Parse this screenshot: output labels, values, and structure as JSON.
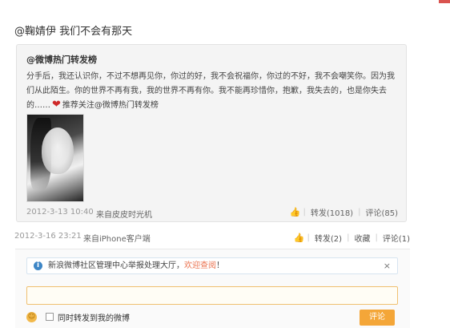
{
  "post": {
    "text": "@鞠婧伊 我们不会有那天",
    "time": "2012-3-16 23:21",
    "source": "来自iPhone客户端",
    "actions": {
      "forward": "转发(2)",
      "favorite": "收藏",
      "comment": "评论(1)"
    }
  },
  "original": {
    "author": "@微博热门转发榜",
    "text": "分手后，我还认识你，不过不想再见你，你过的好，我不会祝福你，你过的不好，我不会嘲笑你。因为我们从此陌生。你的世界不再有我，我的世界不再有你。我不能再珍惜你，抱歉，我失去的，也是你失去的……",
    "recommend": "推荐关注@微博热门转发榜",
    "time": "2012-3-13 10:40",
    "source": "来自皮皮时光机",
    "actions": {
      "forward": "转发(1018)",
      "comment": "评论(85)"
    }
  },
  "comment_box": {
    "notice": "新浪微博社区管理中心举报处理大厅，",
    "notice_link": "欢迎查阅",
    "notice_end": "！",
    "close": "×",
    "checkbox_label": "同时转发到我的微博",
    "submit": "评论"
  },
  "colors": {
    "accent": "#eb7350",
    "submit": "#f4a638",
    "notice_icon": "#3d86c6",
    "heart": "#cf2a2a"
  },
  "icons": [
    "like-icon",
    "heart-icon",
    "info-icon",
    "close-icon",
    "emoji-icon"
  ]
}
